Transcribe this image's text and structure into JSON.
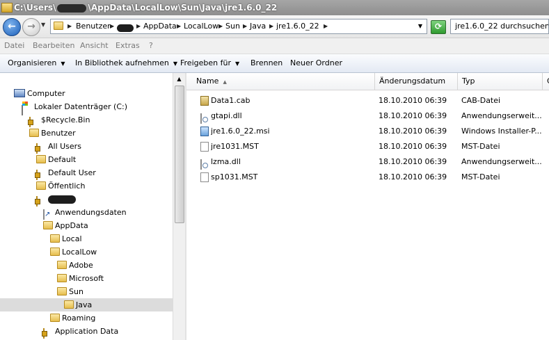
{
  "window": {
    "title_parts": [
      "C:\\Users\\",
      "\\AppData\\LocalLow\\Sun\\Java\\jre1.6.0_22"
    ]
  },
  "address": {
    "crumbs": [
      "Benutzer",
      "AppData",
      "LocalLow",
      "Sun",
      "Java",
      "jre1.6.0_22"
    ],
    "search_placeholder": "jre1.6.0_22 durchsuchen"
  },
  "menu": [
    "Datei",
    "Bearbeiten",
    "Ansicht",
    "Extras",
    "?"
  ],
  "commands": [
    "Organisieren",
    "In Bibliothek aufnehmen",
    "Freigeben für",
    "Brennen",
    "Neuer Ordner"
  ],
  "tree": [
    {
      "label": "Computer",
      "icon": "computer-icon"
    },
    {
      "label": "Lokaler Datenträger (C:)",
      "icon": "drive-icon"
    },
    {
      "label": "$Recycle.Bin",
      "icon": "locked-folder-icon"
    },
    {
      "label": "Benutzer",
      "icon": "folder-icon"
    },
    {
      "label": "All Users",
      "icon": "locked-folder-icon"
    },
    {
      "label": "Default",
      "icon": "folder-icon"
    },
    {
      "label": "Default User",
      "icon": "locked-folder-icon"
    },
    {
      "label": "Öffentlich",
      "icon": "folder-icon"
    },
    {
      "label": "",
      "icon": "locked-folder-icon"
    },
    {
      "label": "Anwendungsdaten",
      "icon": "shortcut-icon"
    },
    {
      "label": "AppData",
      "icon": "folder-icon"
    },
    {
      "label": "Local",
      "icon": "folder-icon"
    },
    {
      "label": "LocalLow",
      "icon": "folder-icon"
    },
    {
      "label": "Adobe",
      "icon": "folder-icon"
    },
    {
      "label": "Microsoft",
      "icon": "folder-icon"
    },
    {
      "label": "Sun",
      "icon": "folder-icon"
    },
    {
      "label": "Java",
      "icon": "folder-icon",
      "selected": true
    },
    {
      "label": "Roaming",
      "icon": "folder-icon"
    },
    {
      "label": "Application Data",
      "icon": "locked-folder-icon"
    }
  ],
  "columns": {
    "name": "Name",
    "date": "Änderungsdatum",
    "type": "Typ",
    "size": "G"
  },
  "files": [
    {
      "name": "Data1.cab",
      "date": "18.10.2010 06:39",
      "type": "CAB-Datei",
      "icon": "cab-file-icon"
    },
    {
      "name": "gtapi.dll",
      "date": "18.10.2010 06:39",
      "type": "Anwendungserweit...",
      "icon": "dll-file-icon"
    },
    {
      "name": "jre1.6.0_22.msi",
      "date": "18.10.2010 06:39",
      "type": "Windows Installer-P...",
      "icon": "msi-file-icon"
    },
    {
      "name": "jre1031.MST",
      "date": "18.10.2010 06:39",
      "type": "MST-Datei",
      "icon": "document-icon"
    },
    {
      "name": "lzma.dll",
      "date": "18.10.2010 06:39",
      "type": "Anwendungserweit...",
      "icon": "dll-file-icon"
    },
    {
      "name": "sp1031.MST",
      "date": "18.10.2010 06:39",
      "type": "MST-Datei",
      "icon": "document-icon"
    }
  ]
}
